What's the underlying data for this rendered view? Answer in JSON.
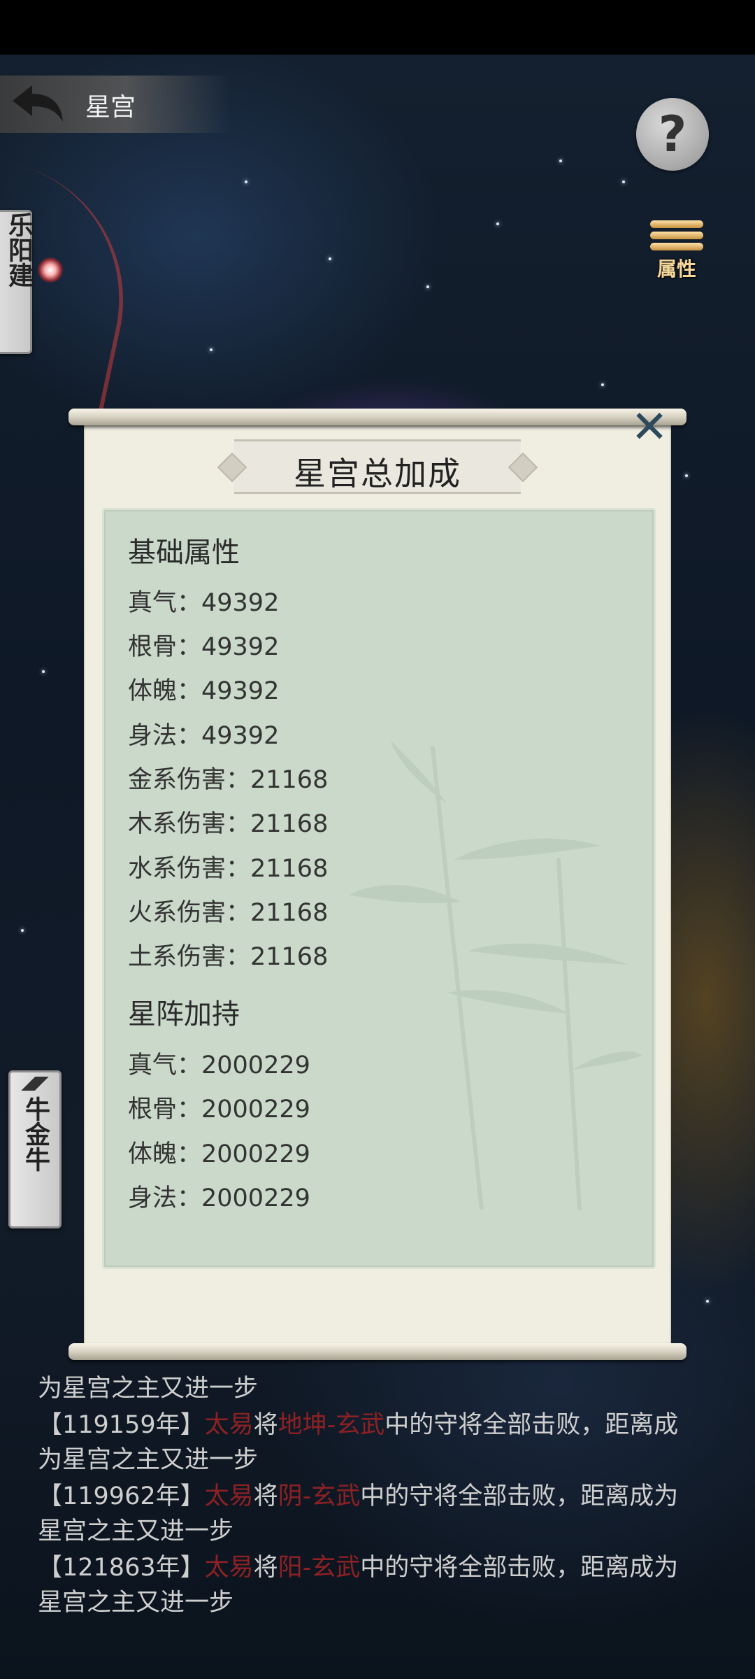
{
  "header": {
    "title": "星宫"
  },
  "buttons": {
    "help_symbol": "?",
    "attributes_label": "属性",
    "close_symbol": "✕"
  },
  "side_tabs": {
    "top": "乐阳建",
    "bottom": "牛金牛"
  },
  "dialog": {
    "title": "星宫总加成",
    "sections": [
      {
        "title": "基础属性",
        "stats": [
          "真气：49392",
          "根骨：49392",
          "体魄：49392",
          "身法：49392",
          "金系伤害：21168",
          "木系伤害：21168",
          "水系伤害：21168",
          "火系伤害：21168",
          "土系伤害：21168"
        ]
      },
      {
        "title": "星阵加持",
        "stats": [
          "真气：2000229",
          "根骨：2000229",
          "体魄：2000229",
          "身法：2000229"
        ]
      }
    ]
  },
  "log": [
    {
      "line1": "为星宫之主又进一步"
    },
    {
      "year": "【119159年】",
      "name": "太易",
      "mid": "将",
      "place": "地坤-玄武",
      "rest": "中的守将全部击败，距离成",
      "line2": "为星宫之主又进一步"
    },
    {
      "year": "【119962年】",
      "name": "太易",
      "mid": "将",
      "place": "阴-玄武",
      "rest": "中的守将全部击败，距离成为",
      "line2": "星宫之主又进一步"
    },
    {
      "year": "【121863年】",
      "name": "太易",
      "mid": "将",
      "place": "阳-玄武",
      "rest": "中的守将全部击败，距离成为",
      "line2": "星宫之主又进一步"
    }
  ],
  "colors": {
    "highlight": "#8d2124",
    "panel": "#efeee0",
    "card": "#cad9ca"
  }
}
